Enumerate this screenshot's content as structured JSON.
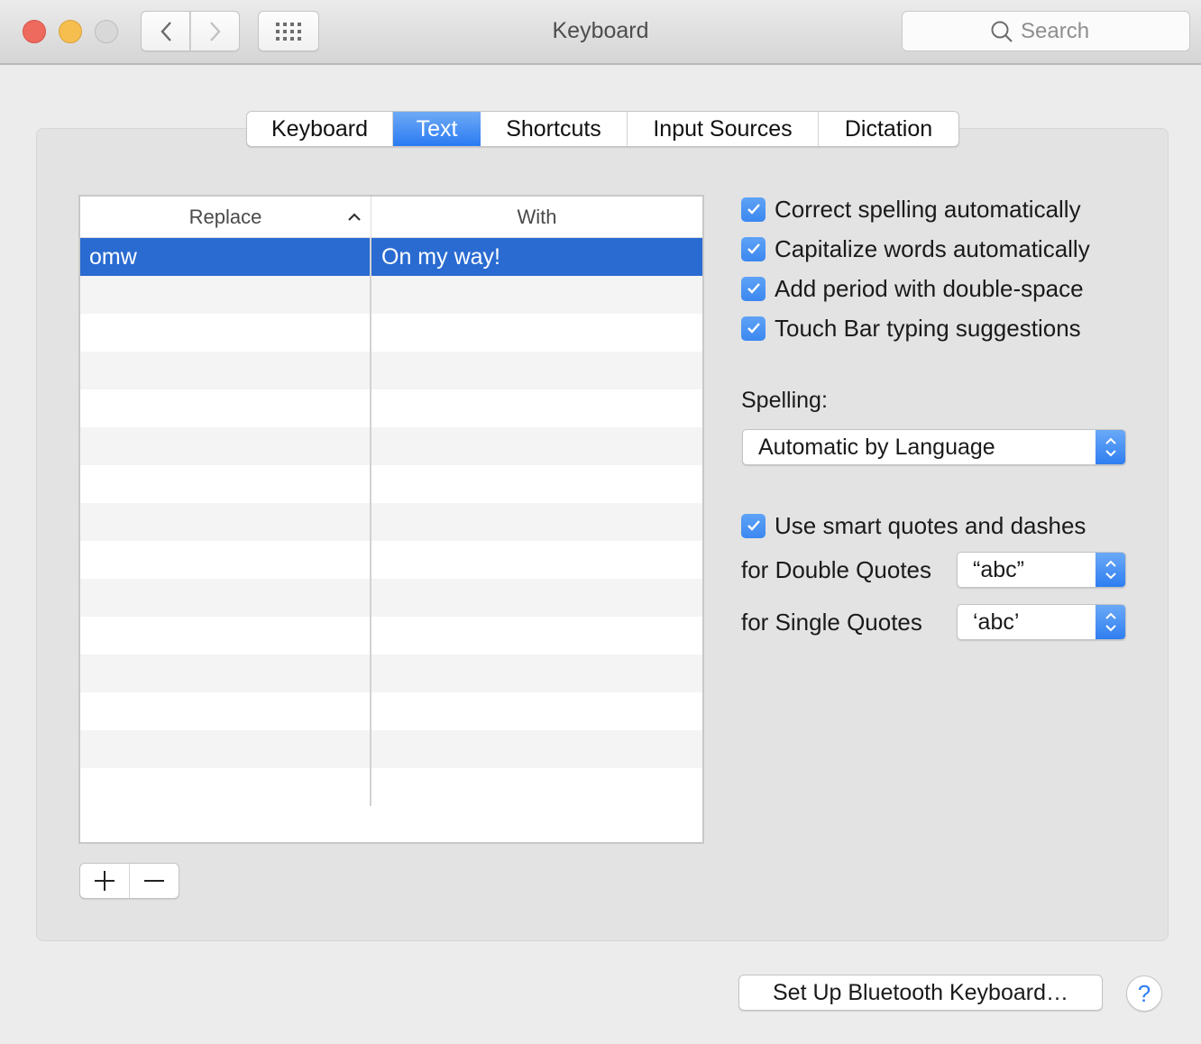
{
  "window": {
    "title": "Keyboard",
    "search_placeholder": "Search"
  },
  "tabs": [
    {
      "label": "Keyboard",
      "active": false
    },
    {
      "label": "Text",
      "active": true
    },
    {
      "label": "Shortcuts",
      "active": false
    },
    {
      "label": "Input Sources",
      "active": false
    },
    {
      "label": "Dictation",
      "active": false
    }
  ],
  "table": {
    "columns": {
      "replace": "Replace",
      "with": "With"
    },
    "sort_indicator": "ascending",
    "rows": [
      {
        "replace": "omw",
        "with": "On my way!",
        "selected": true
      }
    ]
  },
  "list_controls": {
    "add": "+",
    "remove": "−"
  },
  "options": [
    {
      "label": "Correct spelling automatically",
      "checked": true
    },
    {
      "label": "Capitalize words automatically",
      "checked": true
    },
    {
      "label": "Add period with double-space",
      "checked": true
    },
    {
      "label": "Touch Bar typing suggestions",
      "checked": true
    }
  ],
  "spelling": {
    "label": "Spelling:",
    "value": "Automatic by Language"
  },
  "smart_quotes": {
    "label": "Use smart quotes and dashes",
    "checked": true,
    "double_label": "for Double Quotes",
    "double_value": "“abc”",
    "single_label": "for Single Quotes",
    "single_value": "‘abc’"
  },
  "footer": {
    "bluetooth_button": "Set Up Bluetooth Keyboard…",
    "help": "?"
  },
  "colors": {
    "accent": "#2a7bf2",
    "selection": "#2a6bd1"
  }
}
